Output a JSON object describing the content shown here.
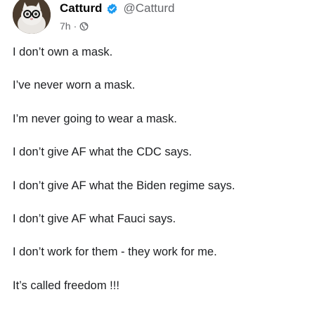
{
  "post": {
    "author": {
      "name": "Catturd",
      "handle": "@Catturd"
    },
    "timestamp": "7h",
    "separator": "·",
    "privacy_icon": "globe-icon",
    "verified_icon": "verified-badge-icon",
    "verified_color": "#1d9bf0",
    "lines": [
      "I don’t own a mask.",
      "I’ve never worn a mask.",
      "I’m never going to wear a mask.",
      "I don’t give AF what the CDC says.",
      "I don’t give AF what the Biden regime says.",
      "I don’t give AF what Fauci says.",
      "I don’t work for them - they work for me.",
      "It’s called freedom !!!"
    ]
  }
}
